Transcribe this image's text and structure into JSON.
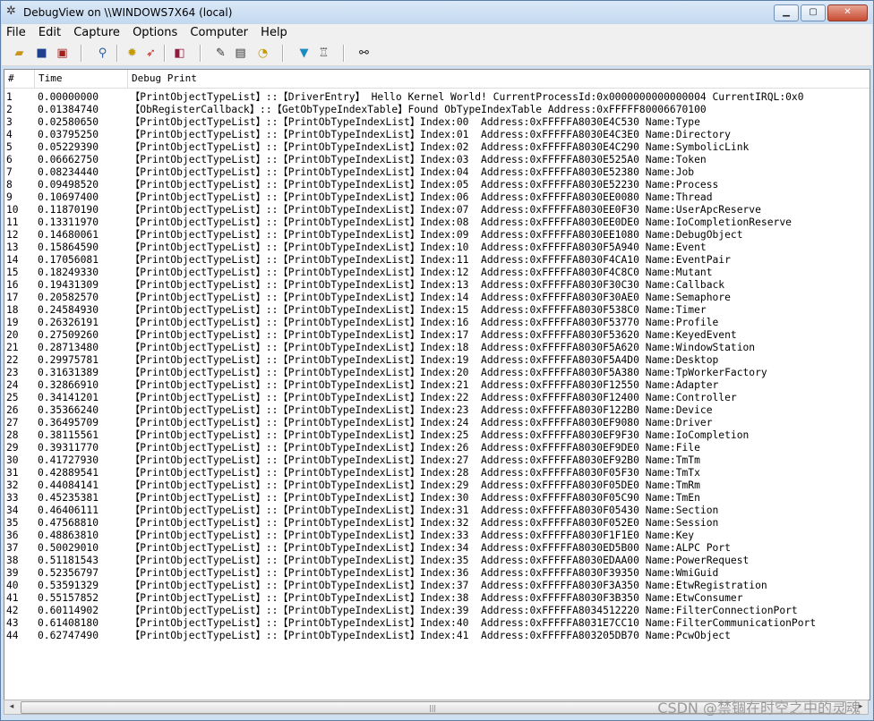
{
  "window": {
    "title": "DebugView on \\\\WINDOWS7X64 (local)"
  },
  "menu": [
    "File",
    "Edit",
    "Capture",
    "Options",
    "Computer",
    "Help"
  ],
  "toolbar_icons": [
    "open-icon",
    "save-icon",
    "clear-icon",
    "find-icon",
    "capture-icon",
    "autoscroll-icon",
    "history-icon",
    "timestamp-icon",
    "clock-icon",
    "filter-icon",
    "highlight-icon",
    "search-icon"
  ],
  "columns": {
    "num": "#",
    "time": "Time",
    "msg": "Debug Print"
  },
  "rows": [
    [
      "1",
      "0.00000000",
      "【PrintObjectTypeList】::【DriverEntry】 Hello Kernel World! CurrentProcessId:0x0000000000000004 CurrentIRQL:0x0"
    ],
    [
      "2",
      "0.01384740",
      "【ObRegisterCallback】::【GetObTypeIndexTable】Found ObTypeIndexTable Address:0xFFFFF80006670100"
    ],
    [
      "3",
      "0.02580650",
      "【PrintObjectTypeList】::【PrintObTypeIndexList】Index:00  Address:0xFFFFFA8030E4C530 Name:Type"
    ],
    [
      "4",
      "0.03795250",
      "【PrintObjectTypeList】::【PrintObTypeIndexList】Index:01  Address:0xFFFFFA8030E4C3E0 Name:Directory"
    ],
    [
      "5",
      "0.05229390",
      "【PrintObjectTypeList】::【PrintObTypeIndexList】Index:02  Address:0xFFFFFA8030E4C290 Name:SymbolicLink"
    ],
    [
      "6",
      "0.06662750",
      "【PrintObjectTypeList】::【PrintObTypeIndexList】Index:03  Address:0xFFFFFA8030E525A0 Name:Token"
    ],
    [
      "7",
      "0.08234440",
      "【PrintObjectTypeList】::【PrintObTypeIndexList】Index:04  Address:0xFFFFFA8030E52380 Name:Job"
    ],
    [
      "8",
      "0.09498520",
      "【PrintObjectTypeList】::【PrintObTypeIndexList】Index:05  Address:0xFFFFFA8030E52230 Name:Process"
    ],
    [
      "9",
      "0.10697400",
      "【PrintObjectTypeList】::【PrintObTypeIndexList】Index:06  Address:0xFFFFFA8030EE0080 Name:Thread"
    ],
    [
      "10",
      "0.11870190",
      "【PrintObjectTypeList】::【PrintObTypeIndexList】Index:07  Address:0xFFFFFA8030EE0F30 Name:UserApcReserve"
    ],
    [
      "11",
      "0.13311970",
      "【PrintObjectTypeList】::【PrintObTypeIndexList】Index:08  Address:0xFFFFFA8030EE0DE0 Name:IoCompletionReserve"
    ],
    [
      "12",
      "0.14680061",
      "【PrintObjectTypeList】::【PrintObTypeIndexList】Index:09  Address:0xFFFFFA8030EE1080 Name:DebugObject"
    ],
    [
      "13",
      "0.15864590",
      "【PrintObjectTypeList】::【PrintObTypeIndexList】Index:10  Address:0xFFFFFA8030F5A940 Name:Event"
    ],
    [
      "14",
      "0.17056081",
      "【PrintObjectTypeList】::【PrintObTypeIndexList】Index:11  Address:0xFFFFFA8030F4CA10 Name:EventPair"
    ],
    [
      "15",
      "0.18249330",
      "【PrintObjectTypeList】::【PrintObTypeIndexList】Index:12  Address:0xFFFFFA8030F4C8C0 Name:Mutant"
    ],
    [
      "16",
      "0.19431309",
      "【PrintObjectTypeList】::【PrintObTypeIndexList】Index:13  Address:0xFFFFFA8030F30C30 Name:Callback"
    ],
    [
      "17",
      "0.20582570",
      "【PrintObjectTypeList】::【PrintObTypeIndexList】Index:14  Address:0xFFFFFA8030F30AE0 Name:Semaphore"
    ],
    [
      "18",
      "0.24584930",
      "【PrintObjectTypeList】::【PrintObTypeIndexList】Index:15  Address:0xFFFFFA8030F538C0 Name:Timer"
    ],
    [
      "19",
      "0.26326191",
      "【PrintObjectTypeList】::【PrintObTypeIndexList】Index:16  Address:0xFFFFFA8030F53770 Name:Profile"
    ],
    [
      "20",
      "0.27509260",
      "【PrintObjectTypeList】::【PrintObTypeIndexList】Index:17  Address:0xFFFFFA8030F53620 Name:KeyedEvent"
    ],
    [
      "21",
      "0.28713480",
      "【PrintObjectTypeList】::【PrintObTypeIndexList】Index:18  Address:0xFFFFFA8030F5A620 Name:WindowStation"
    ],
    [
      "22",
      "0.29975781",
      "【PrintObjectTypeList】::【PrintObTypeIndexList】Index:19  Address:0xFFFFFA8030F5A4D0 Name:Desktop"
    ],
    [
      "23",
      "0.31631389",
      "【PrintObjectTypeList】::【PrintObTypeIndexList】Index:20  Address:0xFFFFFA8030F5A380 Name:TpWorkerFactory"
    ],
    [
      "24",
      "0.32866910",
      "【PrintObjectTypeList】::【PrintObTypeIndexList】Index:21  Address:0xFFFFFA8030F12550 Name:Adapter"
    ],
    [
      "25",
      "0.34141201",
      "【PrintObjectTypeList】::【PrintObTypeIndexList】Index:22  Address:0xFFFFFA8030F12400 Name:Controller"
    ],
    [
      "26",
      "0.35366240",
      "【PrintObjectTypeList】::【PrintObTypeIndexList】Index:23  Address:0xFFFFFA8030F122B0 Name:Device"
    ],
    [
      "27",
      "0.36495709",
      "【PrintObjectTypeList】::【PrintObTypeIndexList】Index:24  Address:0xFFFFFA8030EF9080 Name:Driver"
    ],
    [
      "28",
      "0.38115561",
      "【PrintObjectTypeList】::【PrintObTypeIndexList】Index:25  Address:0xFFFFFA8030EF9F30 Name:IoCompletion"
    ],
    [
      "29",
      "0.39311770",
      "【PrintObjectTypeList】::【PrintObTypeIndexList】Index:26  Address:0xFFFFFA8030EF9DE0 Name:File"
    ],
    [
      "30",
      "0.41727930",
      "【PrintObjectTypeList】::【PrintObTypeIndexList】Index:27  Address:0xFFFFFA8030EF92B0 Name:TmTm"
    ],
    [
      "31",
      "0.42889541",
      "【PrintObjectTypeList】::【PrintObTypeIndexList】Index:28  Address:0xFFFFFA8030F05F30 Name:TmTx"
    ],
    [
      "32",
      "0.44084141",
      "【PrintObjectTypeList】::【PrintObTypeIndexList】Index:29  Address:0xFFFFFA8030F05DE0 Name:TmRm"
    ],
    [
      "33",
      "0.45235381",
      "【PrintObjectTypeList】::【PrintObTypeIndexList】Index:30  Address:0xFFFFFA8030F05C90 Name:TmEn"
    ],
    [
      "34",
      "0.46406111",
      "【PrintObjectTypeList】::【PrintObTypeIndexList】Index:31  Address:0xFFFFFA8030F05430 Name:Section"
    ],
    [
      "35",
      "0.47568810",
      "【PrintObjectTypeList】::【PrintObTypeIndexList】Index:32  Address:0xFFFFFA8030F052E0 Name:Session"
    ],
    [
      "36",
      "0.48863810",
      "【PrintObjectTypeList】::【PrintObTypeIndexList】Index:33  Address:0xFFFFFA8030F1F1E0 Name:Key"
    ],
    [
      "37",
      "0.50029010",
      "【PrintObjectTypeList】::【PrintObTypeIndexList】Index:34  Address:0xFFFFFA8030ED5B00 Name:ALPC Port"
    ],
    [
      "38",
      "0.51181543",
      "【PrintObjectTypeList】::【PrintObTypeIndexList】Index:35  Address:0xFFFFFA8030EDAA00 Name:PowerRequest"
    ],
    [
      "39",
      "0.52356797",
      "【PrintObjectTypeList】::【PrintObTypeIndexList】Index:36  Address:0xFFFFFA8030F39350 Name:WmiGuid"
    ],
    [
      "40",
      "0.53591329",
      "【PrintObjectTypeList】::【PrintObTypeIndexList】Index:37  Address:0xFFFFFA8030F3A350 Name:EtwRegistration"
    ],
    [
      "41",
      "0.55157852",
      "【PrintObjectTypeList】::【PrintObTypeIndexList】Index:38  Address:0xFFFFFA8030F3B350 Name:EtwConsumer"
    ],
    [
      "42",
      "0.60114902",
      "【PrintObjectTypeList】::【PrintObTypeIndexList】Index:39  Address:0xFFFFFA8034512220 Name:FilterConnectionPort"
    ],
    [
      "43",
      "0.61408180",
      "【PrintObjectTypeList】::【PrintObTypeIndexList】Index:40  Address:0xFFFFFA8031E7CC10 Name:FilterCommunicationPort"
    ],
    [
      "44",
      "0.62747490",
      "【PrintObjectTypeList】::【PrintObTypeIndexList】Index:41  Address:0xFFFFFA803205DB70 Name:PcwObject"
    ]
  ],
  "scrollbar": {
    "left_arrow": "◂",
    "right_arrow": "▸",
    "grip": "|||"
  },
  "watermark": "CSDN @禁锢在时空之中的灵魂"
}
